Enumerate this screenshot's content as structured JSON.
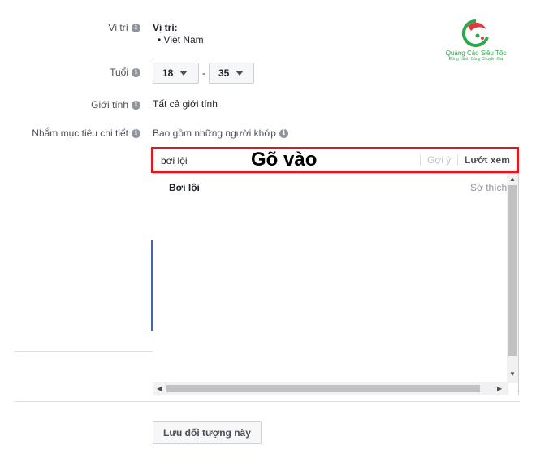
{
  "location": {
    "label": "Vị trí",
    "title": "Vị trí:",
    "items": [
      "Việt Nam"
    ]
  },
  "age": {
    "label": "Tuổi",
    "min": "18",
    "separator": "-",
    "max": "35"
  },
  "gender": {
    "label": "Giới tính",
    "value": "Tất cả giới tính"
  },
  "detailed_targeting": {
    "label": "Nhắm mục tiêu chi tiết",
    "include_text": "Bao gồm những người khớp",
    "search_value": "bơi lội",
    "overlay_text": "Gõ vào",
    "suggest_label": "Gợi ý",
    "browse_label": "Lướt xem",
    "results": [
      {
        "name": "Bơi lội",
        "category": "Sở thích"
      }
    ]
  },
  "logo": {
    "brand": "Quảng Cáo Siêu Tốc",
    "tagline": "Đồng Hành Cùng Chuyên Gia"
  },
  "save_button": "Lưu đối tượng này",
  "colors": {
    "highlight": "#e4161b",
    "logo_green": "#2aa84a",
    "logo_red": "#e03a3e"
  }
}
